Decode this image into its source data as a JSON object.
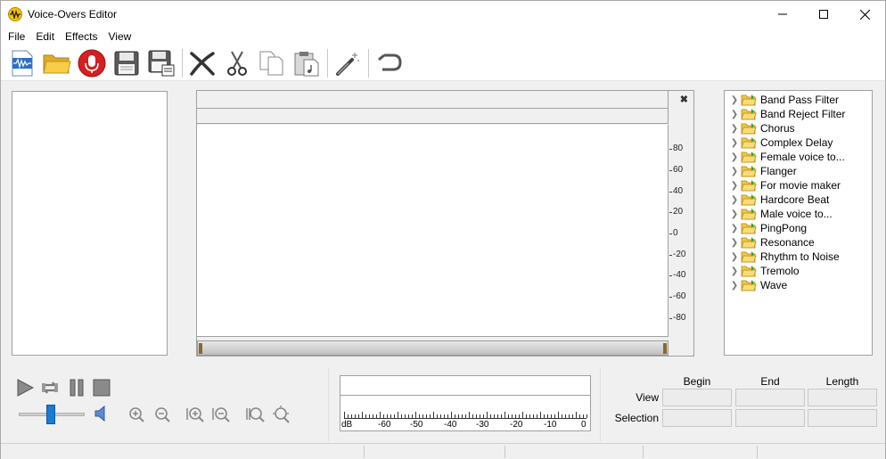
{
  "window": {
    "title": "Voice-Overs Editor"
  },
  "menu": [
    "File",
    "Edit",
    "Effects",
    "View"
  ],
  "toolbar": {
    "buttons": [
      "new-audio",
      "open-folder",
      "record",
      "save",
      "save-as",
      "delete",
      "cut",
      "copy",
      "paste",
      "magic-effect",
      "undo"
    ]
  },
  "waveform": {
    "scale_labels": [
      "80",
      "60",
      "40",
      "20",
      "0",
      "-20",
      "-40",
      "-60",
      "-80"
    ],
    "close_glyph": "✖"
  },
  "effects_tree": {
    "items": [
      "Band Pass Filter",
      "Band Reject Filter",
      "Chorus",
      "Complex Delay",
      "Female voice to...",
      "Flanger",
      "For movie maker",
      "Hardcore Beat",
      "Male voice to...",
      "PingPong",
      "Resonance",
      "Rhythm to Noise",
      "Tremolo",
      "Wave"
    ]
  },
  "playback": {
    "volume_level": 0.45
  },
  "meter": {
    "labels": [
      "dB",
      "-60",
      "-50",
      "-40",
      "-30",
      "-20",
      "-10",
      "0"
    ]
  },
  "selection_info": {
    "columns": [
      "Begin",
      "End",
      "Length"
    ],
    "rows": [
      "View",
      "Selection"
    ]
  }
}
